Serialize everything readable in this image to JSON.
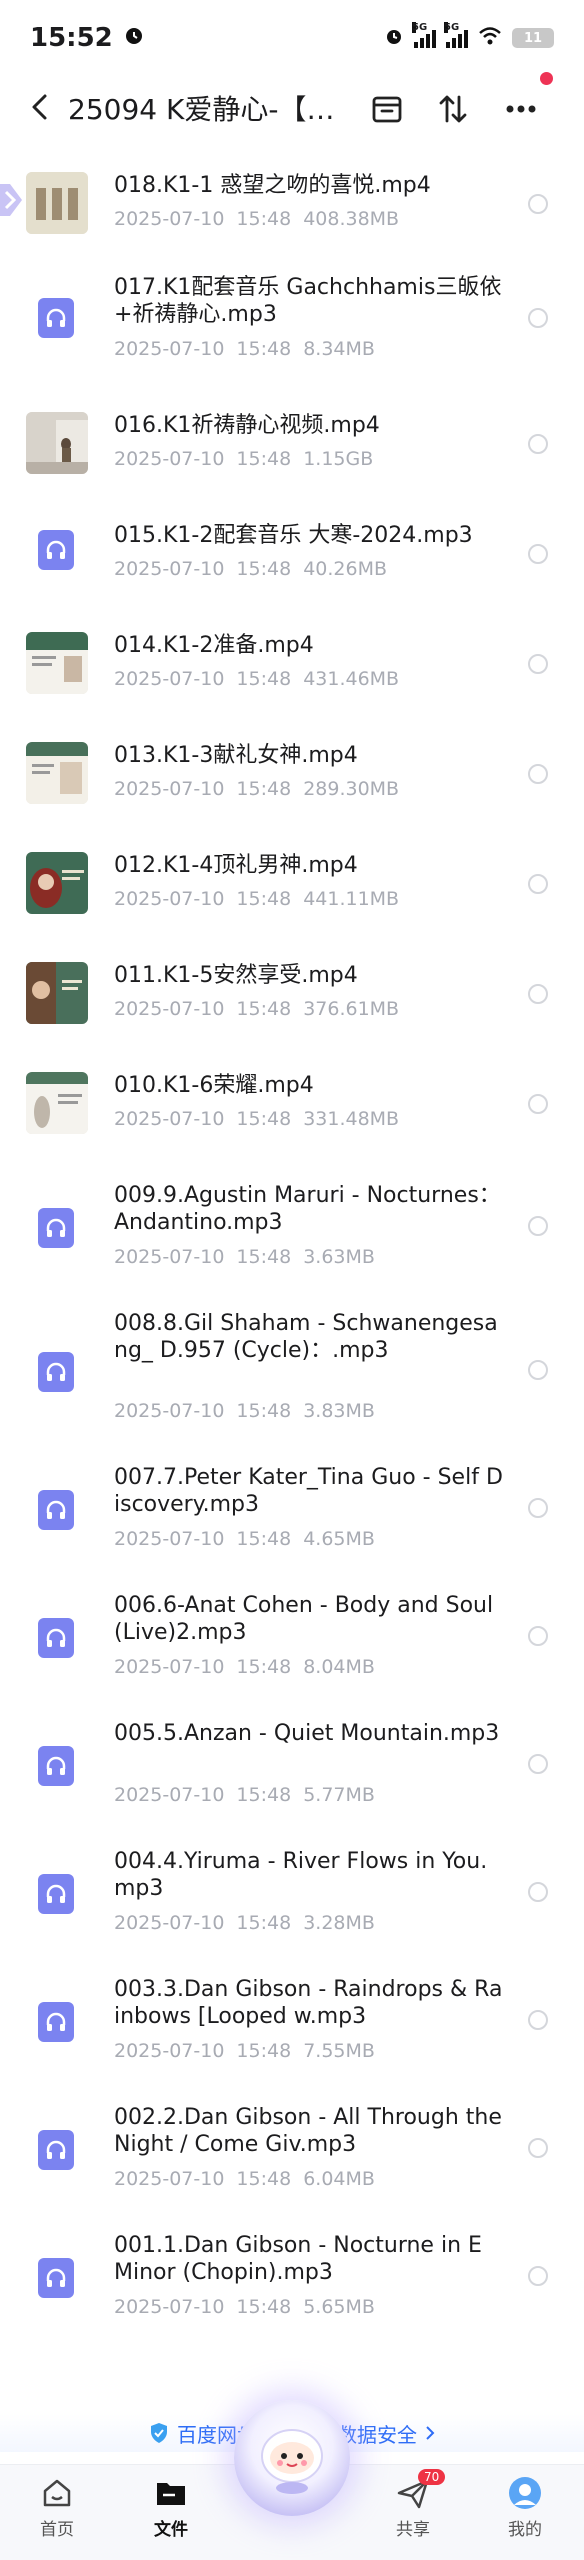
{
  "status_bar": {
    "time": "15:52",
    "network_1": "5G",
    "network_2": "5G",
    "battery": "11"
  },
  "header": {
    "title": "25094 K爱静心-【…"
  },
  "files": [
    {
      "type": "video",
      "name": "018.K1-1 惑望之吻的喜悦.mp4",
      "date": "2025-07-10",
      "time": "15:48",
      "size": "408.38MB"
    },
    {
      "type": "audio",
      "name": "017.K1配套音乐 Gachchhamis三皈依+祈祷静心.mp3",
      "date": "2025-07-10",
      "time": "15:48",
      "size": "8.34MB"
    },
    {
      "type": "video",
      "name": "016.K1祈祷静心视频.mp4",
      "date": "2025-07-10",
      "time": "15:48",
      "size": "1.15GB"
    },
    {
      "type": "audio",
      "name": "015.K1-2配套音乐 大寒-2024.mp3",
      "date": "2025-07-10",
      "time": "15:48",
      "size": "40.26MB"
    },
    {
      "type": "video",
      "name": "014.K1-2准备.mp4",
      "date": "2025-07-10",
      "time": "15:48",
      "size": "431.46MB"
    },
    {
      "type": "video",
      "name": "013.K1-3献礼女神.mp4",
      "date": "2025-07-10",
      "time": "15:48",
      "size": "289.30MB"
    },
    {
      "type": "video",
      "name": "012.K1-4顶礼男神.mp4",
      "date": "2025-07-10",
      "time": "15:48",
      "size": "441.11MB"
    },
    {
      "type": "video",
      "name": "011.K1-5安然享受.mp4",
      "date": "2025-07-10",
      "time": "15:48",
      "size": "376.61MB"
    },
    {
      "type": "video",
      "name": "010.K1-6荣耀.mp4",
      "date": "2025-07-10",
      "time": "15:48",
      "size": "331.48MB"
    },
    {
      "type": "audio",
      "name": "009.9.Agustin Maruri - Nocturnes：Andantino.mp3",
      "date": "2025-07-10",
      "time": "15:48",
      "size": "3.63MB"
    },
    {
      "type": "audio",
      "name": "008.8.Gil Shaham - Schwanengesang_ D.957 (Cycle)：.mp3",
      "date": "2025-07-10",
      "time": "15:48",
      "size": "3.83MB"
    },
    {
      "type": "audio",
      "name": "007.7.Peter Kater_Tina Guo - Self Discovery.mp3",
      "date": "2025-07-10",
      "time": "15:48",
      "size": "4.65MB"
    },
    {
      "type": "audio",
      "name": "006.6-Anat Cohen - Body and Soul (Live)2.mp3",
      "date": "2025-07-10",
      "time": "15:48",
      "size": "8.04MB"
    },
    {
      "type": "audio",
      "name": "005.5.Anzan - Quiet Mountain.mp3",
      "date": "2025-07-10",
      "time": "15:48",
      "size": "5.77MB"
    },
    {
      "type": "audio",
      "name": "004.4.Yiruma - River Flows in You.mp3",
      "date": "2025-07-10",
      "time": "15:48",
      "size": "3.28MB"
    },
    {
      "type": "audio",
      "name": "003.3.Dan Gibson - Raindrops & Rainbows [Looped w.mp3",
      "date": "2025-07-10",
      "time": "15:48",
      "size": "7.55MB"
    },
    {
      "type": "audio",
      "name": "002.2.Dan Gibson - All Through the Night / Come Giv.mp3",
      "date": "2025-07-10",
      "time": "15:48",
      "size": "6.04MB"
    },
    {
      "type": "audio",
      "name": "001.1.Dan Gibson - Nocturne in E Minor (Chopin).mp3",
      "date": "2025-07-10",
      "time": "15:48",
      "size": "5.65MB"
    }
  ],
  "security_note": "百度网盘保障你的数据安全",
  "bottom_nav": {
    "home": "首页",
    "files": "文件",
    "share": "共享",
    "share_badge": "70",
    "mine": "我的"
  },
  "colors": {
    "accent": "#2e6df6",
    "audio_icon": "#7b83f0",
    "meta_text": "#a8abb3",
    "badge": "#ee3344"
  }
}
